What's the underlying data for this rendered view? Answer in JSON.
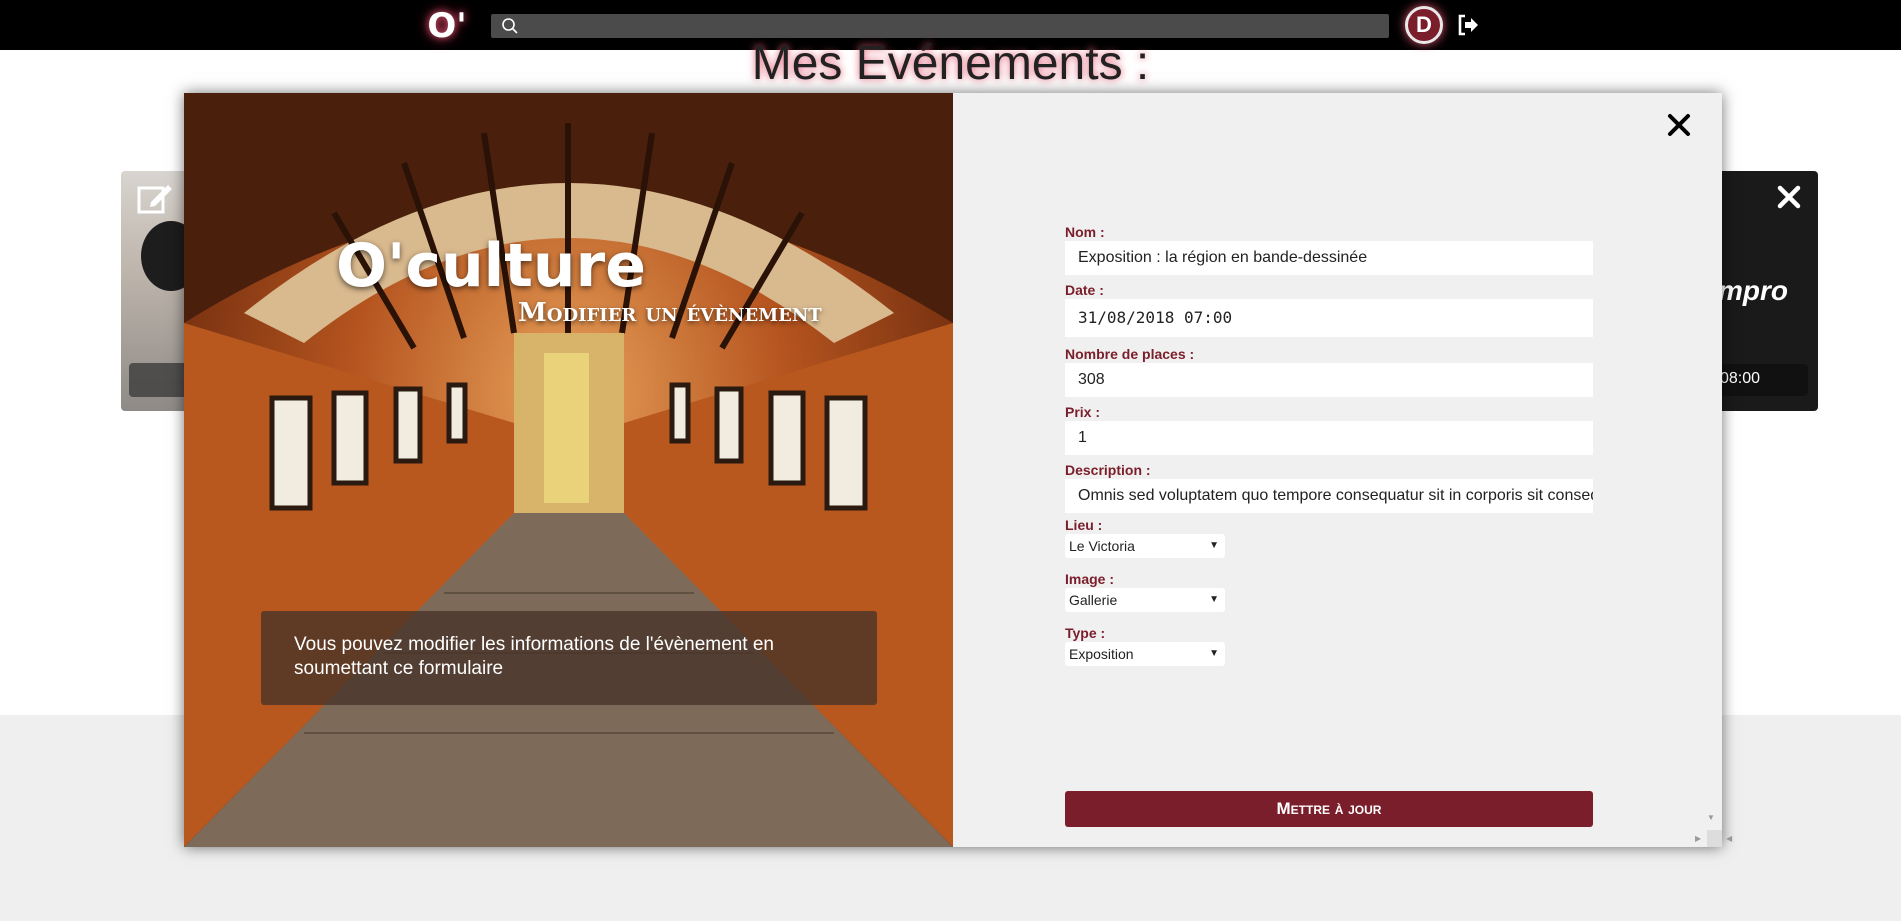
{
  "navbar": {
    "logo": "O'",
    "avatar_initial": "D"
  },
  "page": {
    "title": "Mes Evénements :"
  },
  "bg_cards": {
    "right_word": "mpro",
    "right_time": "08:00"
  },
  "modal": {
    "brand": "O'culture",
    "subtitle": "Modifier un évènement",
    "info_text": "Vous pouvez modifier les informations de l'évènement en soumettant ce formulaire",
    "form": {
      "nom": {
        "label": "Nom :",
        "value": "Exposition : la région en bande-dessinée"
      },
      "date": {
        "label": "Date :",
        "value": "31/08/2018 07:00"
      },
      "places": {
        "label": "Nombre de places :",
        "value": "308"
      },
      "prix": {
        "label": "Prix :",
        "value": "1"
      },
      "description": {
        "label": "Description :",
        "value": "Omnis sed voluptatem quo tempore consequatur sit in corporis sit consequuntur"
      },
      "lieu": {
        "label": "Lieu :",
        "value": "Le Victoria"
      },
      "image": {
        "label": "Image :",
        "value": "Gallerie"
      },
      "type": {
        "label": "Type :",
        "value": "Exposition"
      },
      "submit_label": "Mettre à jour"
    }
  },
  "colors": {
    "accent": "#7b1e2b",
    "glow": "#e0566f",
    "navbar": "#000000"
  }
}
